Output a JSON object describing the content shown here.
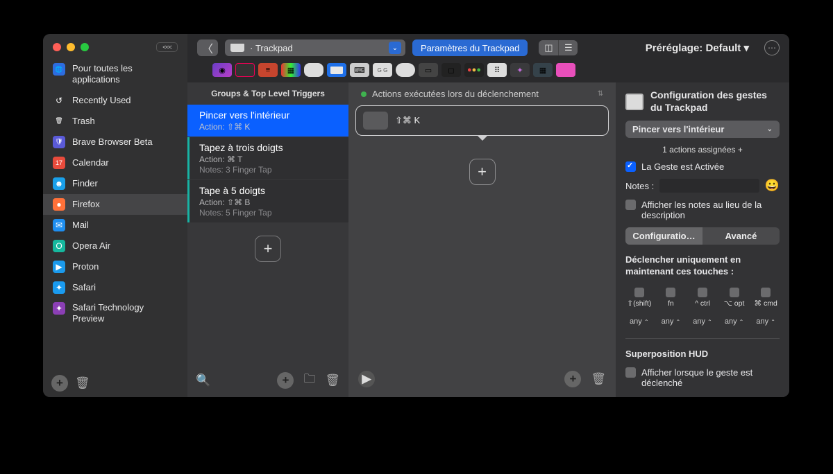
{
  "sidebar": {
    "collapse": "<<<",
    "items": [
      {
        "label": "Pour toutes les applications",
        "icon": "🌐",
        "bg": "#2d6de0"
      },
      {
        "label": "Recently Used",
        "icon": "↺",
        "bg": "transparent"
      },
      {
        "label": "Trash",
        "icon": "🗑",
        "bg": "transparent"
      },
      {
        "label": "Brave Browser Beta",
        "icon": "🛡",
        "bg": "#5a5ad8"
      },
      {
        "label": "Calendar",
        "icon": "17",
        "bg": "#e84b3c"
      },
      {
        "label": "Finder",
        "icon": "☻",
        "bg": "#1aa0ea"
      },
      {
        "label": "Firefox",
        "icon": "●",
        "bg": "#ff7139"
      },
      {
        "label": "Mail",
        "icon": "✉",
        "bg": "#1e8ef0"
      },
      {
        "label": "Opera Air",
        "icon": "O",
        "bg": "#16b89e"
      },
      {
        "label": "Proton",
        "icon": "▶",
        "bg": "#1b9aec"
      },
      {
        "label": "Safari",
        "icon": "✦",
        "bg": "#1a9bf0"
      },
      {
        "label": "Safari Technology Preview",
        "icon": "✦",
        "bg": "#8b3fb5"
      }
    ],
    "selectedIndex": 6
  },
  "toolbar": {
    "breadcrumb_prefix": "·",
    "breadcrumb": "Trackpad",
    "params_btn": "Paramètres du Trackpad",
    "preset_label": "Préréglage: Default ▾"
  },
  "col1": {
    "header": "Groups & Top Level Triggers",
    "triggers": [
      {
        "title": "Pincer vers l'intérieur",
        "action": "Action: ⇧⌘ K",
        "note": null,
        "selected": true
      },
      {
        "title": "Tapez à trois doigts",
        "action": "Action: ⌘ T",
        "note": "Notes: 3 Finger Tap",
        "selected": false
      },
      {
        "title": "Tape à 5 doigts",
        "action": "Action: ⇧⌘ B",
        "note": "Notes: 5 Finger Tap",
        "selected": false
      }
    ]
  },
  "col2": {
    "header": "Actions exécutées lors du déclenchement",
    "shortcut": "⇧⌘ K"
  },
  "col3": {
    "title": "Configuration des gestes du Trackpad",
    "dropdown": "Pincer vers l'intérieur",
    "assigned": "1 actions assignées +",
    "enabled": "La Geste est Activée",
    "notes_label": "Notes :",
    "show_notes": "Afficher les notes au lieu de la description",
    "tab_conf": "Configuratio…",
    "tab_adv": "Avancé",
    "mod_header": "Déclencher uniquement en maintenant ces touches :",
    "mods": [
      "⇧(shift)",
      "fn",
      "^ ctrl",
      "⌥ opt",
      "⌘ cmd"
    ],
    "any": "any",
    "hud_header": "Superposition HUD",
    "hud_check": "Afficher lorsque le geste est déclenché"
  }
}
